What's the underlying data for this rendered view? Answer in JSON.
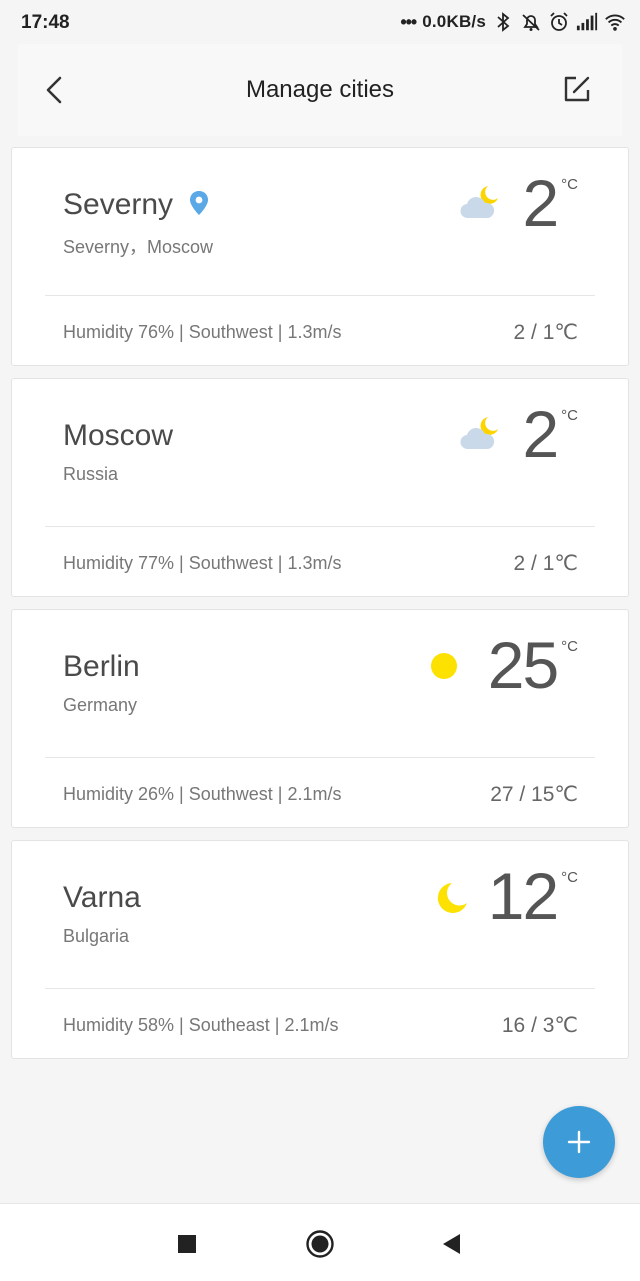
{
  "status_bar": {
    "time": "17:48",
    "speed": "0.0KB/s",
    "icons": [
      "bluetooth-icon",
      "bell-off-icon",
      "alarm-icon",
      "signal-icon",
      "wifi-icon"
    ]
  },
  "header": {
    "title": "Manage cities",
    "back_icon": "chevron-left-icon",
    "edit_icon": "edit-icon"
  },
  "cities": [
    {
      "name": "Severny",
      "subtitle": "Severny，Moscow",
      "temp": "2",
      "unit": "°C",
      "details": "Humidity 76% | Southwest | 1.3m/s",
      "range": "2 / 1℃",
      "weather_icon": "cloudy-night-icon",
      "has_location_pin": true
    },
    {
      "name": "Moscow",
      "subtitle": "Russia",
      "temp": "2",
      "unit": "°C",
      "details": "Humidity 77% | Southwest | 1.3m/s",
      "range": "2 / 1℃",
      "weather_icon": "cloudy-night-icon",
      "has_location_pin": false
    },
    {
      "name": "Berlin",
      "subtitle": "Germany",
      "temp": "25",
      "unit": "°C",
      "details": "Humidity 26% | Southwest | 2.1m/s",
      "range": "27 / 15℃",
      "weather_icon": "sun-icon",
      "has_location_pin": false
    },
    {
      "name": "Varna",
      "subtitle": "Bulgaria",
      "temp": "12",
      "unit": "°C",
      "details": "Humidity 58% | Southeast | 2.1m/s",
      "range": "16 / 3℃",
      "weather_icon": "moon-icon",
      "has_location_pin": false
    }
  ],
  "fab": {
    "icon": "plus-icon"
  },
  "nav_bar": {
    "icons": [
      "recents-square-icon",
      "home-circle-icon",
      "back-triangle-icon"
    ]
  },
  "colors": {
    "accent": "#3d9bd8",
    "sun": "#fde100",
    "cloud": "#c9d9ea",
    "progress": "#4ccf4c"
  }
}
